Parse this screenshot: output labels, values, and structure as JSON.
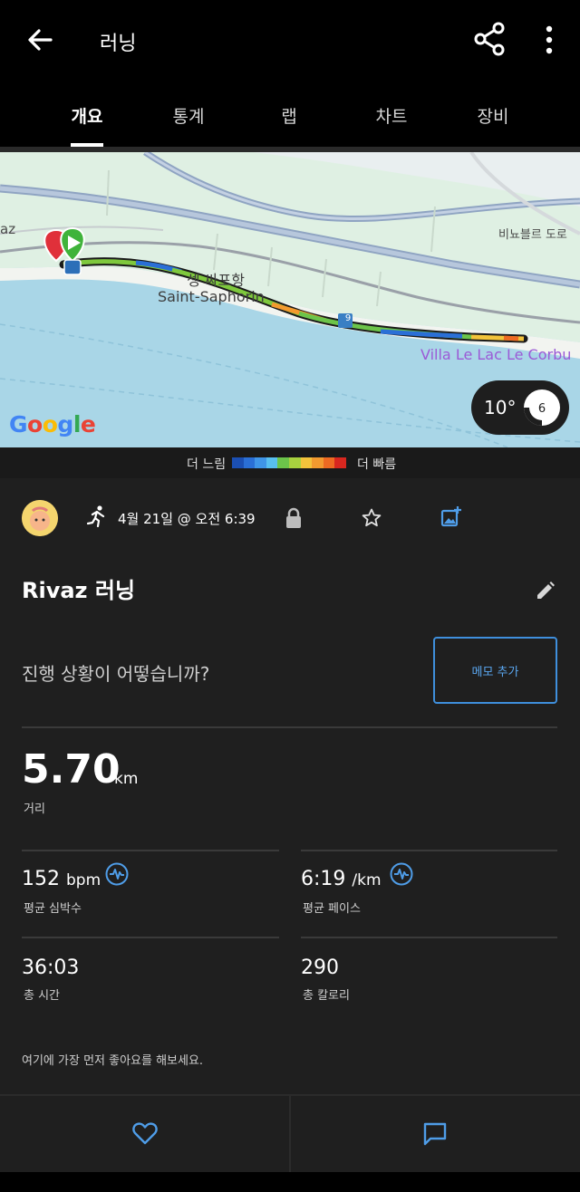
{
  "header": {
    "title": "러닝"
  },
  "tabs": [
    {
      "label": "개요",
      "active": true
    },
    {
      "label": "통계",
      "active": false
    },
    {
      "label": "랩",
      "active": false
    },
    {
      "label": "차트",
      "active": false
    },
    {
      "label": "장비",
      "active": false
    }
  ],
  "map": {
    "labels": {
      "edge_left": "az",
      "road": "비뇨블르 도로",
      "place_kr": "셍 싸포항",
      "place": "Saint-Saphorin",
      "villa": "Villa Le Lac Le Corbu",
      "route_number": "9"
    },
    "attribution": "Google",
    "weather": {
      "temperature": "10°",
      "wind": "6"
    }
  },
  "legend": {
    "slow": "더 느림",
    "fast": "더 빠름",
    "colors": [
      "#1b4fb3",
      "#2a6fd6",
      "#3f95e8",
      "#58c0f0",
      "#6cc44a",
      "#a8d23f",
      "#f3c33b",
      "#f39a2f",
      "#ee6a22",
      "#d8271f"
    ]
  },
  "activity": {
    "date": "4월 21일 @ 오전 6:39",
    "title": "Rivaz 러닝",
    "prompt": "진행 상황이 어떻습니까?",
    "memo_button": "메모 추가",
    "distance": {
      "value": "5.70",
      "unit": "km",
      "label": "거리"
    },
    "heart_rate": {
      "value": "152",
      "unit": "bpm",
      "label": "평균 심박수"
    },
    "pace": {
      "value": "6:19",
      "unit": "/km",
      "label": "평균 페이스"
    },
    "time": {
      "value": "36:03",
      "label": "총 시간"
    },
    "calories": {
      "value": "290",
      "label": "총 칼로리"
    },
    "like_prompt": "여기에 가장 먼저 좋아요를 해보세요."
  },
  "colors": {
    "accent": "#3f8fdc",
    "background": "#1f1f1f",
    "header": "#000000"
  },
  "icons": [
    "back-arrow-icon",
    "share-icon",
    "more-vertical-icon",
    "running-icon",
    "lock-icon",
    "star-icon",
    "add-photo-icon",
    "pencil-icon",
    "pulse-icon",
    "heart-icon",
    "comment-icon"
  ]
}
